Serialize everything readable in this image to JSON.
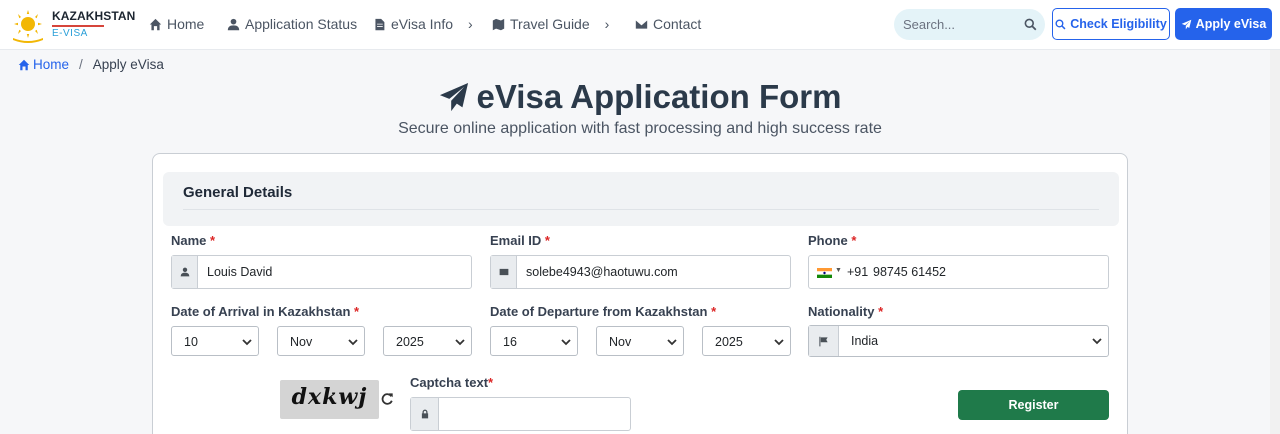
{
  "brand": {
    "title": "KAZAKHSTAN",
    "subtitle": "E-VISA"
  },
  "nav": {
    "home": "Home",
    "application_status": "Application Status",
    "evisa_info": "eVisa Info",
    "travel_guide": "Travel Guide",
    "contact": "Contact",
    "chevron": "›"
  },
  "search": {
    "placeholder": "Search..."
  },
  "header_buttons": {
    "check": "Check Eligibility",
    "apply": "Apply eVisa"
  },
  "breadcrumb": {
    "home": "Home",
    "separator": "/",
    "current": "Apply eVisa"
  },
  "page": {
    "title": "eVisa Application Form",
    "subtitle": "Secure online application with fast processing and high success rate"
  },
  "form": {
    "section_title": "General Details",
    "required_mark": "*",
    "name": {
      "label": "Name",
      "value": "Louis David"
    },
    "email": {
      "label": "Email ID",
      "value": "solebe4943@haotuwu.com"
    },
    "phone": {
      "label": "Phone",
      "dial_code": "+91",
      "value": "98745 61452",
      "flag": "india-flag"
    },
    "arrival": {
      "label": "Date of Arrival in Kazakhstan",
      "day": "10",
      "month": "Nov",
      "year": "2025"
    },
    "departure": {
      "label": "Date of Departure from Kazakhstan",
      "day": "16",
      "month": "Nov",
      "year": "2025"
    },
    "nationality": {
      "label": "Nationality",
      "value": "India"
    },
    "captcha": {
      "image_text": "dxkwj",
      "label": "Captcha text",
      "value": ""
    },
    "register_label": "Register"
  },
  "colors": {
    "primary": "#2563eb",
    "register": "#1f7a4a",
    "required": "#dc2626",
    "title": "#2b3a4a"
  },
  "icons": [
    "home-icon",
    "user-icon",
    "file-icon",
    "map-icon",
    "envelope-icon",
    "search-icon",
    "paper-plane-icon",
    "lock-icon",
    "flag-icon",
    "refresh-icon"
  ]
}
